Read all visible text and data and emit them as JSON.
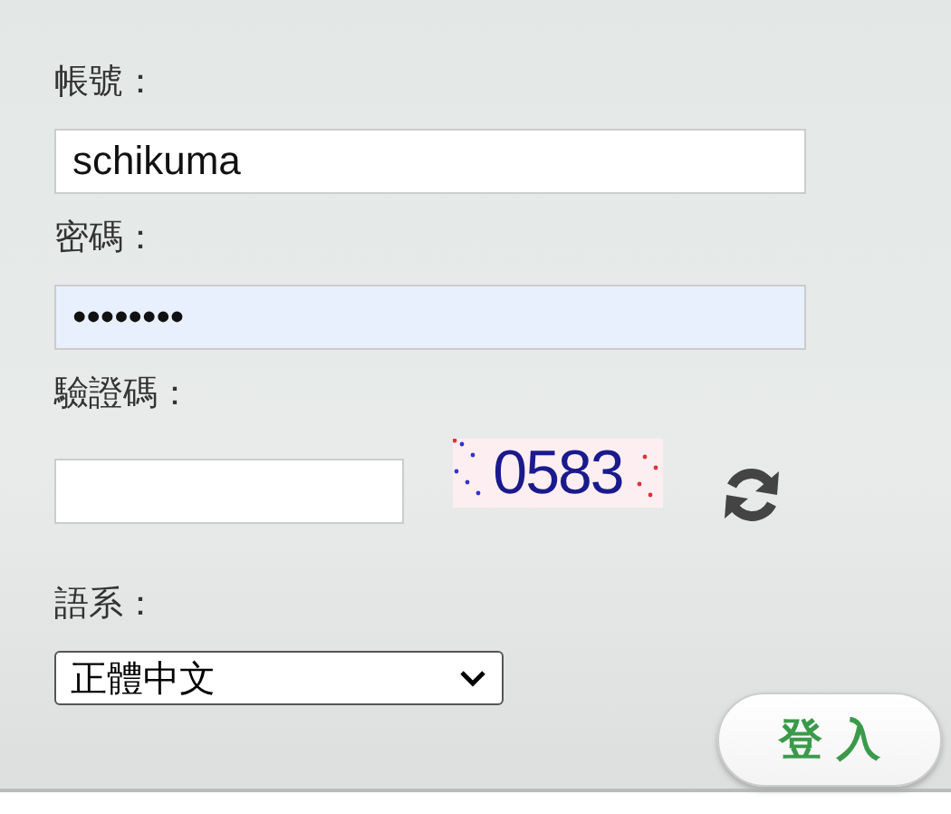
{
  "fields": [
    {
      "kind": "text",
      "label": "帳號：",
      "value": "schikuma",
      "autofilled": false
    },
    {
      "kind": "text",
      "label": "密碼：",
      "value": "••••••••",
      "autofilled": true
    },
    {
      "kind": "captcha",
      "label": "驗證碼：",
      "captcha_text": "0583"
    },
    {
      "kind": "select",
      "label": "語系：",
      "value": "正體中文"
    }
  ],
  "login_button": {
    "label": "登 入"
  }
}
